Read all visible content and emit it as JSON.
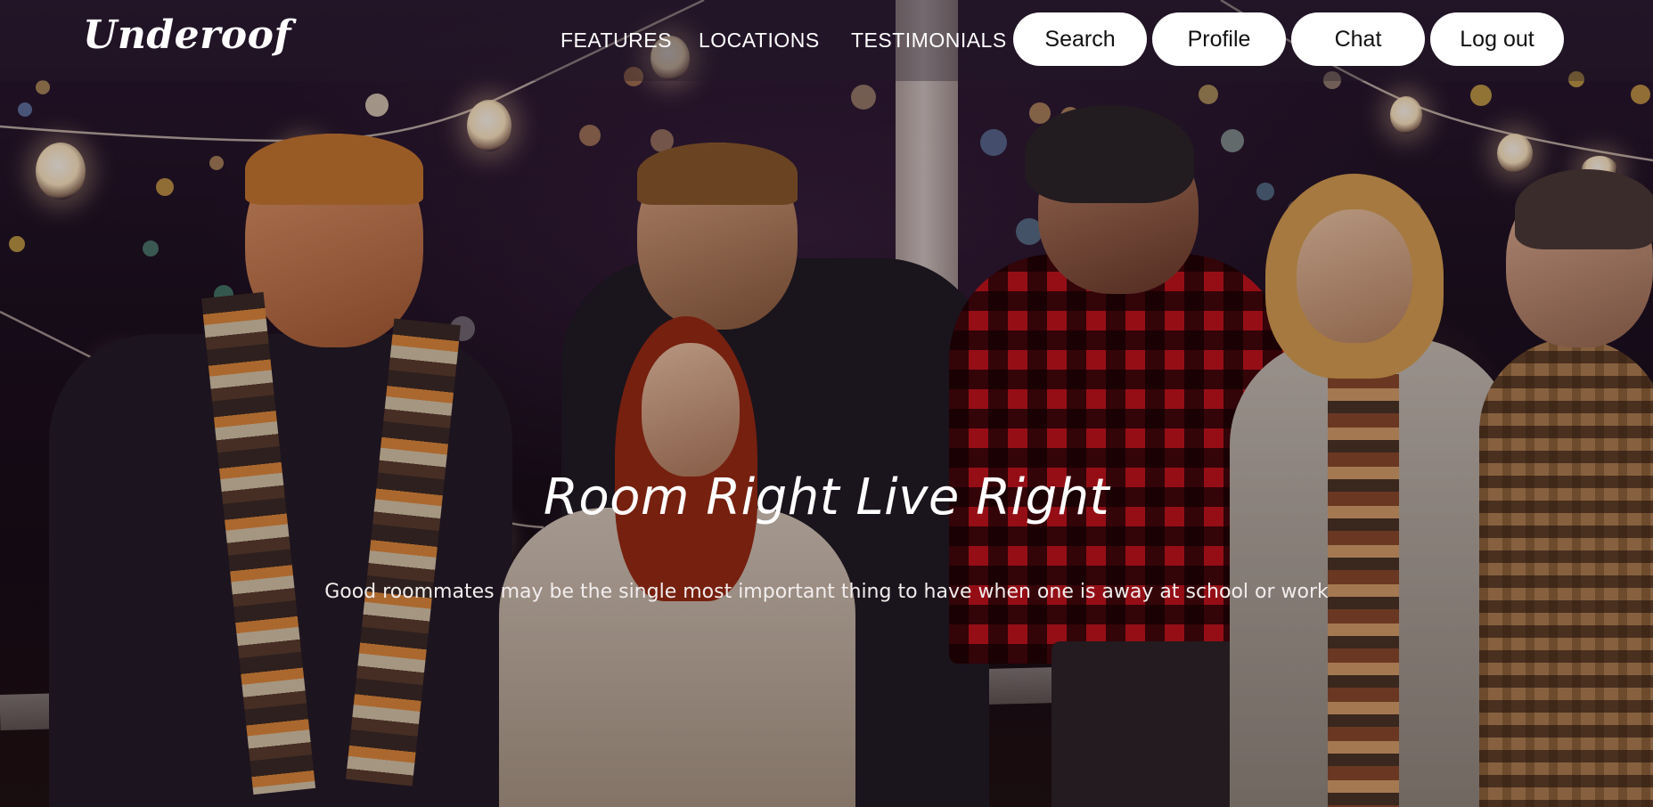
{
  "brand": {
    "logo_text": "Underoof"
  },
  "nav": {
    "links": [
      "FEATURES",
      "LOCATIONS",
      "TESTIMONIALS"
    ],
    "buttons": [
      "Search",
      "Profile",
      "Chat",
      "Log out"
    ]
  },
  "hero": {
    "title": "Room Right Live Right",
    "subtitle": "Good roommates may be the single most important thing to have when one is away at school or work"
  },
  "colors": {
    "button_bg": "#ffffff",
    "text": "#ffffff"
  }
}
